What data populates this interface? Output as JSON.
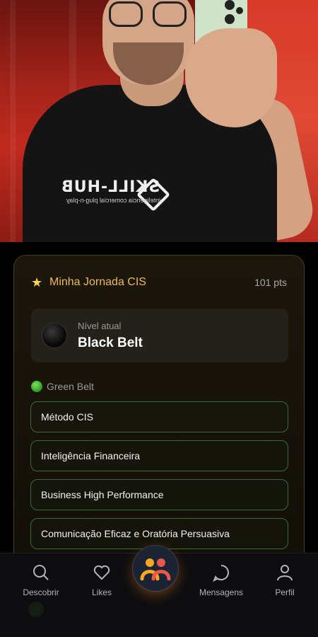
{
  "journey": {
    "title": "Minha Jornada CIS",
    "points": "101 pts",
    "level_label": "Nível atual",
    "level_name": "Black Belt",
    "belt_label": "Green Belt",
    "courses": [
      "Método CIS",
      "Inteligência Financeira",
      "Business High Performance",
      "Comunicação Eficaz e Oratória Persuasiva"
    ]
  },
  "photo": {
    "shirt_brand": "SKILL-HUB",
    "shirt_tagline": "inteligência comercial plug-n-play"
  },
  "nav": {
    "items": [
      {
        "label": "Descobrir",
        "icon": "search-icon"
      },
      {
        "label": "Likes",
        "icon": "heart-icon"
      },
      {
        "label": "",
        "icon": "community-icon"
      },
      {
        "label": "Mensagens",
        "icon": "chat-bubble-icon"
      },
      {
        "label": "Perfil",
        "icon": "user-icon"
      }
    ]
  },
  "colors": {
    "accent": "#f0b85a",
    "green_border": "#3a6a3c",
    "center_glow": "#ff8c28"
  }
}
